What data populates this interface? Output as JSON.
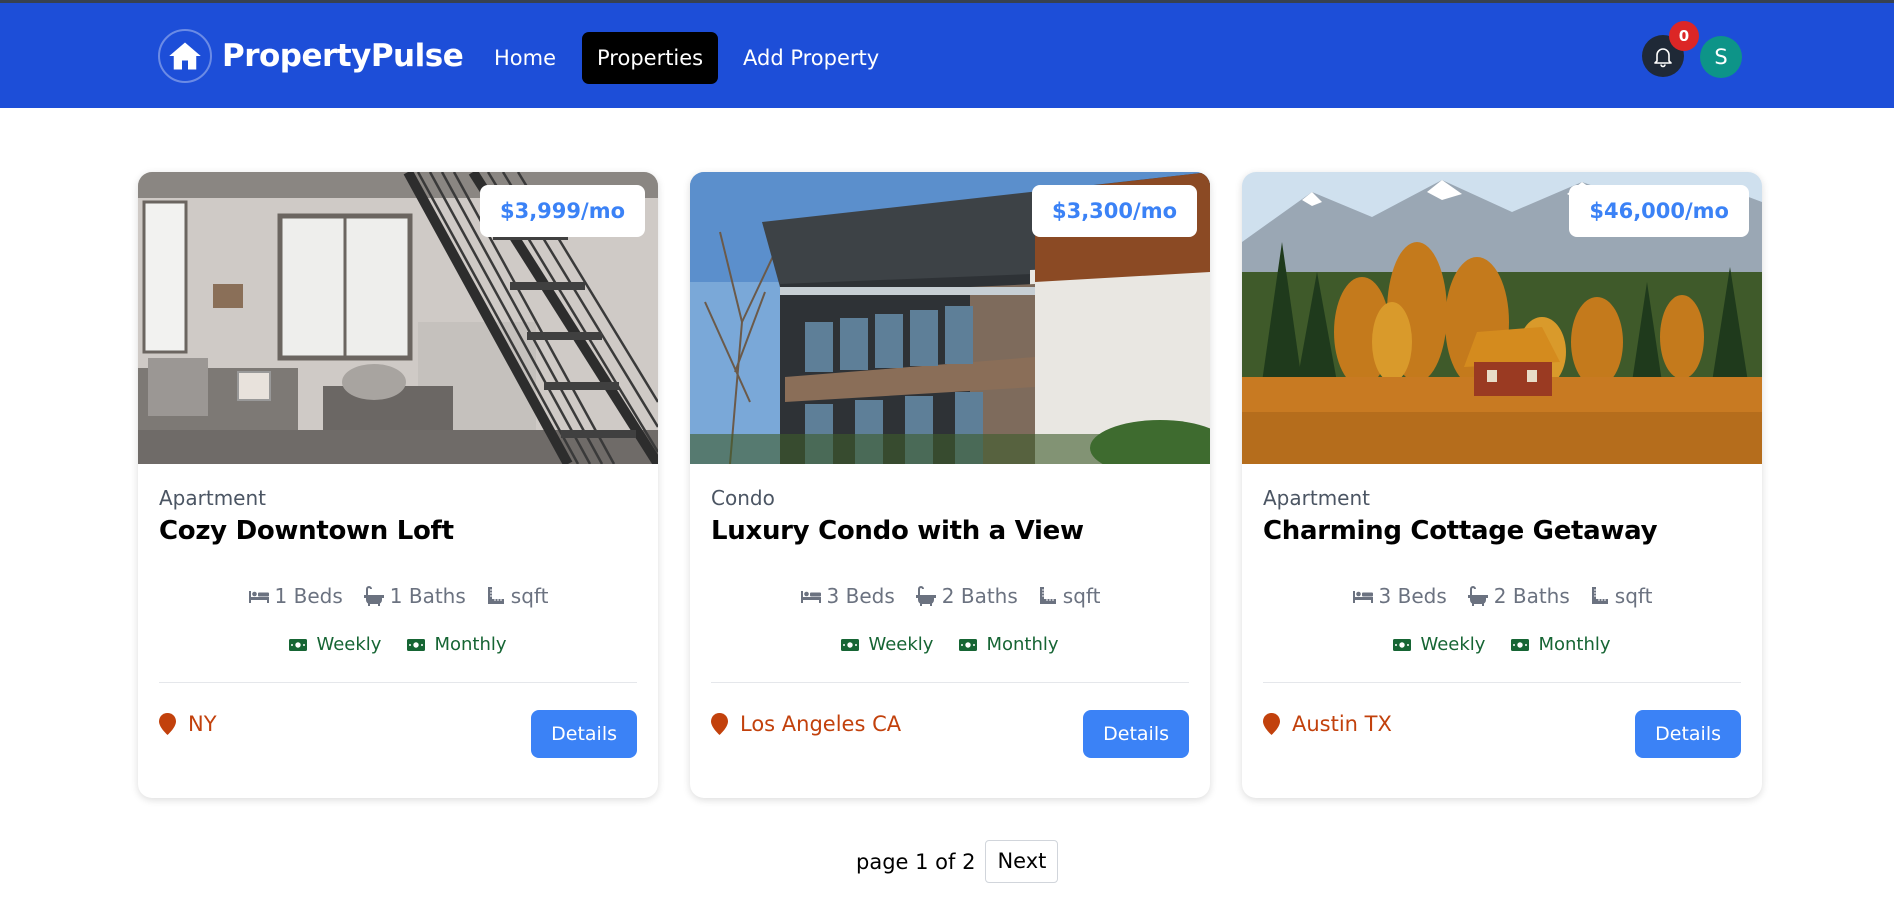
{
  "header": {
    "brand": "PropertyPulse",
    "nav": [
      {
        "label": "Home"
      },
      {
        "label": "Properties",
        "active": true
      },
      {
        "label": "Add Property"
      }
    ],
    "notification_count": "0",
    "avatar_initial": "S"
  },
  "listings": [
    {
      "price": "$3,999/mo",
      "type": "Apartment",
      "name": "Cozy Downtown Loft",
      "beds": "1 Beds",
      "baths": "1 Baths",
      "area": "sqft",
      "rate_weekly": "Weekly",
      "rate_monthly": "Monthly",
      "location": "NY",
      "details_label": "Details"
    },
    {
      "price": "$3,300/mo",
      "type": "Condo",
      "name": "Luxury Condo with a View",
      "beds": "3 Beds",
      "baths": "2 Baths",
      "area": "sqft",
      "rate_weekly": "Weekly",
      "rate_monthly": "Monthly",
      "location": "Los Angeles CA",
      "details_label": "Details"
    },
    {
      "price": "$46,000/mo",
      "type": "Apartment",
      "name": "Charming Cottage Getaway",
      "beds": "3 Beds",
      "baths": "2 Baths",
      "area": "sqft",
      "rate_weekly": "Weekly",
      "rate_monthly": "Monthly",
      "location": "Austin TX",
      "details_label": "Details"
    }
  ],
  "pagination": {
    "status": "page 1 of 2",
    "next_label": "Next"
  },
  "colors": {
    "nav_bg": "#1d4ed8",
    "price_text": "#3b82f6",
    "rate_text": "#166534",
    "location_text": "#c2410c",
    "button_bg": "#3b82f6",
    "badge_bg": "#dc2626",
    "avatar_bg": "#0d9488"
  }
}
